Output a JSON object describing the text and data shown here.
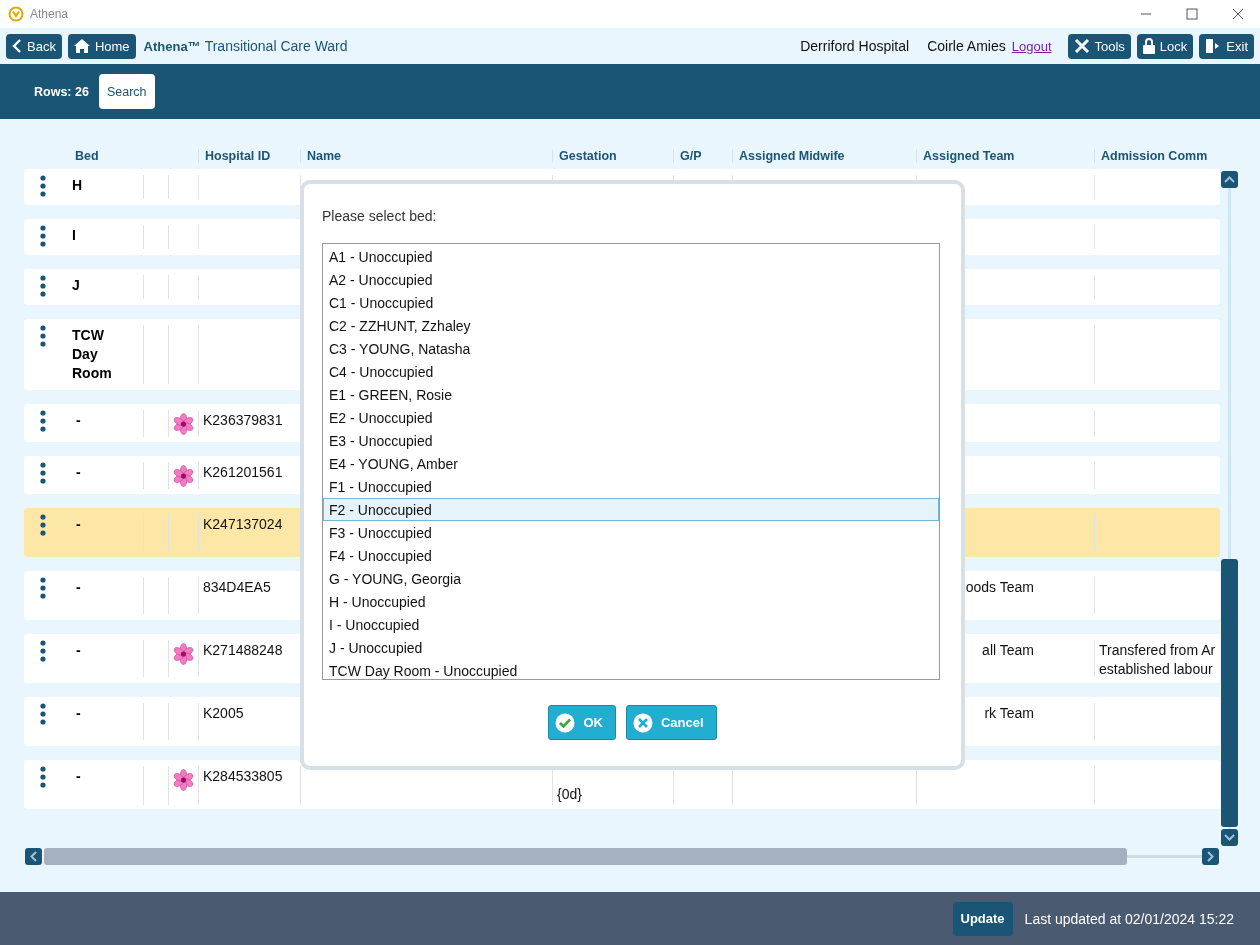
{
  "window": {
    "title": "Athena"
  },
  "nav": {
    "back": "Back",
    "home": "Home",
    "brand": "Athena™",
    "ward": "Transitional Care Ward",
    "hospital": "Derriford Hospital",
    "user": "Coirle Amies",
    "logout": "Logout",
    "tools": "Tools",
    "lock": "Lock",
    "exit": "Exit"
  },
  "toolbar": {
    "rows": "Rows: 26",
    "search": "Search"
  },
  "table": {
    "columns": [
      "Bed",
      "Hospital ID",
      "Name",
      "Gestation",
      "G/P",
      "Assigned Midwife",
      "Assigned Team",
      "Admission Comm"
    ],
    "rows": [
      {
        "bed": "H",
        "marker": false,
        "highlighted": false
      },
      {
        "bed": "I",
        "marker": false,
        "highlighted": false
      },
      {
        "bed": "J",
        "marker": false,
        "highlighted": false
      },
      {
        "bed": "TCW Day Room",
        "marker": false,
        "highlighted": false
      },
      {
        "bed": "-",
        "marker": true,
        "hospital_id": "K236379831",
        "highlighted": false
      },
      {
        "bed": "-",
        "marker": true,
        "hospital_id": "K261201561",
        "highlighted": false
      },
      {
        "bed": "-",
        "marker": false,
        "hospital_id": "K247137024",
        "highlighted": true
      },
      {
        "bed": "-",
        "marker": false,
        "hospital_id": "834D4EA5",
        "team": "oods Team",
        "highlighted": false
      },
      {
        "bed": "-",
        "marker": true,
        "hospital_id": "K271488248",
        "team": "all Team",
        "comment": "Transfered from Ar\nestablished labour",
        "highlighted": false
      },
      {
        "bed": "-",
        "marker": false,
        "hospital_id": "K2005",
        "team": "rk Team",
        "highlighted": false
      },
      {
        "bed": "-",
        "marker": true,
        "hospital_id": "K284533805",
        "gestation": "{0d}",
        "highlighted": false
      }
    ]
  },
  "dialog": {
    "prompt": "Please select bed:",
    "options": [
      {
        "label": "A1 - Unoccupied",
        "selected": false
      },
      {
        "label": "A2 - Unoccupied",
        "selected": false
      },
      {
        "label": "C1 - Unoccupied",
        "selected": false
      },
      {
        "label": "C2 - ZZHUNT, Zzhaley",
        "selected": false
      },
      {
        "label": "C3 - YOUNG, Natasha",
        "selected": false
      },
      {
        "label": "C4 - Unoccupied",
        "selected": false
      },
      {
        "label": "E1 - GREEN, Rosie",
        "selected": false
      },
      {
        "label": "E2 - Unoccupied",
        "selected": false
      },
      {
        "label": "E3 - Unoccupied",
        "selected": false
      },
      {
        "label": "E4 - YOUNG, Amber",
        "selected": false
      },
      {
        "label": "F1 - Unoccupied",
        "selected": false
      },
      {
        "label": "F2 - Unoccupied",
        "selected": true
      },
      {
        "label": "F3 - Unoccupied",
        "selected": false
      },
      {
        "label": "F4 - Unoccupied",
        "selected": false
      },
      {
        "label": "G - YOUNG, Georgia",
        "selected": false
      },
      {
        "label": "H - Unoccupied",
        "selected": false
      },
      {
        "label": "I - Unoccupied",
        "selected": false
      },
      {
        "label": "J - Unoccupied",
        "selected": false
      },
      {
        "label": "TCW Day Room - Unoccupied",
        "selected": false
      }
    ],
    "ok": "OK",
    "cancel": "Cancel"
  },
  "status_bar": {
    "update": "Update",
    "last_updated": "Last updated at 02/01/2024 15:22"
  }
}
